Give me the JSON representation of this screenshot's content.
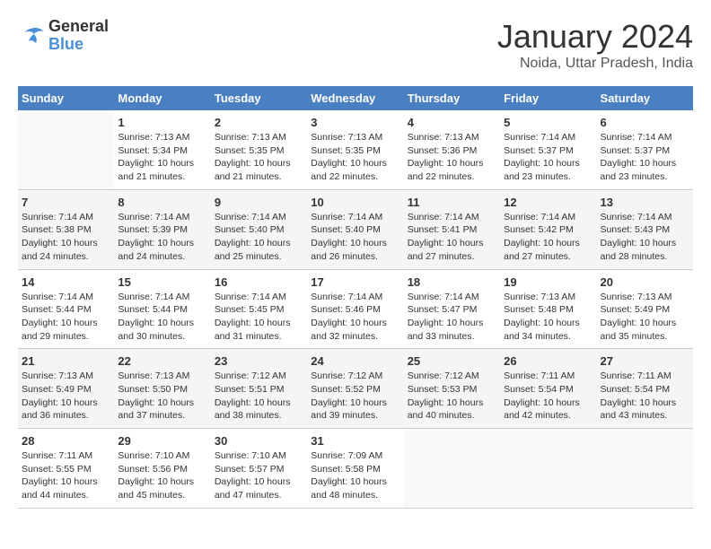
{
  "logo": {
    "line1": "General",
    "line2": "Blue"
  },
  "title": "January 2024",
  "subtitle": "Noida, Uttar Pradesh, India",
  "days_of_week": [
    "Sunday",
    "Monday",
    "Tuesday",
    "Wednesday",
    "Thursday",
    "Friday",
    "Saturday"
  ],
  "weeks": [
    [
      {
        "day": "",
        "info": ""
      },
      {
        "day": "1",
        "info": "Sunrise: 7:13 AM\nSunset: 5:34 PM\nDaylight: 10 hours\nand 21 minutes."
      },
      {
        "day": "2",
        "info": "Sunrise: 7:13 AM\nSunset: 5:35 PM\nDaylight: 10 hours\nand 21 minutes."
      },
      {
        "day": "3",
        "info": "Sunrise: 7:13 AM\nSunset: 5:35 PM\nDaylight: 10 hours\nand 22 minutes."
      },
      {
        "day": "4",
        "info": "Sunrise: 7:13 AM\nSunset: 5:36 PM\nDaylight: 10 hours\nand 22 minutes."
      },
      {
        "day": "5",
        "info": "Sunrise: 7:14 AM\nSunset: 5:37 PM\nDaylight: 10 hours\nand 23 minutes."
      },
      {
        "day": "6",
        "info": "Sunrise: 7:14 AM\nSunset: 5:37 PM\nDaylight: 10 hours\nand 23 minutes."
      }
    ],
    [
      {
        "day": "7",
        "info": "Sunrise: 7:14 AM\nSunset: 5:38 PM\nDaylight: 10 hours\nand 24 minutes."
      },
      {
        "day": "8",
        "info": "Sunrise: 7:14 AM\nSunset: 5:39 PM\nDaylight: 10 hours\nand 24 minutes."
      },
      {
        "day": "9",
        "info": "Sunrise: 7:14 AM\nSunset: 5:40 PM\nDaylight: 10 hours\nand 25 minutes."
      },
      {
        "day": "10",
        "info": "Sunrise: 7:14 AM\nSunset: 5:40 PM\nDaylight: 10 hours\nand 26 minutes."
      },
      {
        "day": "11",
        "info": "Sunrise: 7:14 AM\nSunset: 5:41 PM\nDaylight: 10 hours\nand 27 minutes."
      },
      {
        "day": "12",
        "info": "Sunrise: 7:14 AM\nSunset: 5:42 PM\nDaylight: 10 hours\nand 27 minutes."
      },
      {
        "day": "13",
        "info": "Sunrise: 7:14 AM\nSunset: 5:43 PM\nDaylight: 10 hours\nand 28 minutes."
      }
    ],
    [
      {
        "day": "14",
        "info": "Sunrise: 7:14 AM\nSunset: 5:44 PM\nDaylight: 10 hours\nand 29 minutes."
      },
      {
        "day": "15",
        "info": "Sunrise: 7:14 AM\nSunset: 5:44 PM\nDaylight: 10 hours\nand 30 minutes."
      },
      {
        "day": "16",
        "info": "Sunrise: 7:14 AM\nSunset: 5:45 PM\nDaylight: 10 hours\nand 31 minutes."
      },
      {
        "day": "17",
        "info": "Sunrise: 7:14 AM\nSunset: 5:46 PM\nDaylight: 10 hours\nand 32 minutes."
      },
      {
        "day": "18",
        "info": "Sunrise: 7:14 AM\nSunset: 5:47 PM\nDaylight: 10 hours\nand 33 minutes."
      },
      {
        "day": "19",
        "info": "Sunrise: 7:13 AM\nSunset: 5:48 PM\nDaylight: 10 hours\nand 34 minutes."
      },
      {
        "day": "20",
        "info": "Sunrise: 7:13 AM\nSunset: 5:49 PM\nDaylight: 10 hours\nand 35 minutes."
      }
    ],
    [
      {
        "day": "21",
        "info": "Sunrise: 7:13 AM\nSunset: 5:49 PM\nDaylight: 10 hours\nand 36 minutes."
      },
      {
        "day": "22",
        "info": "Sunrise: 7:13 AM\nSunset: 5:50 PM\nDaylight: 10 hours\nand 37 minutes."
      },
      {
        "day": "23",
        "info": "Sunrise: 7:12 AM\nSunset: 5:51 PM\nDaylight: 10 hours\nand 38 minutes."
      },
      {
        "day": "24",
        "info": "Sunrise: 7:12 AM\nSunset: 5:52 PM\nDaylight: 10 hours\nand 39 minutes."
      },
      {
        "day": "25",
        "info": "Sunrise: 7:12 AM\nSunset: 5:53 PM\nDaylight: 10 hours\nand 40 minutes."
      },
      {
        "day": "26",
        "info": "Sunrise: 7:11 AM\nSunset: 5:54 PM\nDaylight: 10 hours\nand 42 minutes."
      },
      {
        "day": "27",
        "info": "Sunrise: 7:11 AM\nSunset: 5:54 PM\nDaylight: 10 hours\nand 43 minutes."
      }
    ],
    [
      {
        "day": "28",
        "info": "Sunrise: 7:11 AM\nSunset: 5:55 PM\nDaylight: 10 hours\nand 44 minutes."
      },
      {
        "day": "29",
        "info": "Sunrise: 7:10 AM\nSunset: 5:56 PM\nDaylight: 10 hours\nand 45 minutes."
      },
      {
        "day": "30",
        "info": "Sunrise: 7:10 AM\nSunset: 5:57 PM\nDaylight: 10 hours\nand 47 minutes."
      },
      {
        "day": "31",
        "info": "Sunrise: 7:09 AM\nSunset: 5:58 PM\nDaylight: 10 hours\nand 48 minutes."
      },
      {
        "day": "",
        "info": ""
      },
      {
        "day": "",
        "info": ""
      },
      {
        "day": "",
        "info": ""
      }
    ]
  ]
}
